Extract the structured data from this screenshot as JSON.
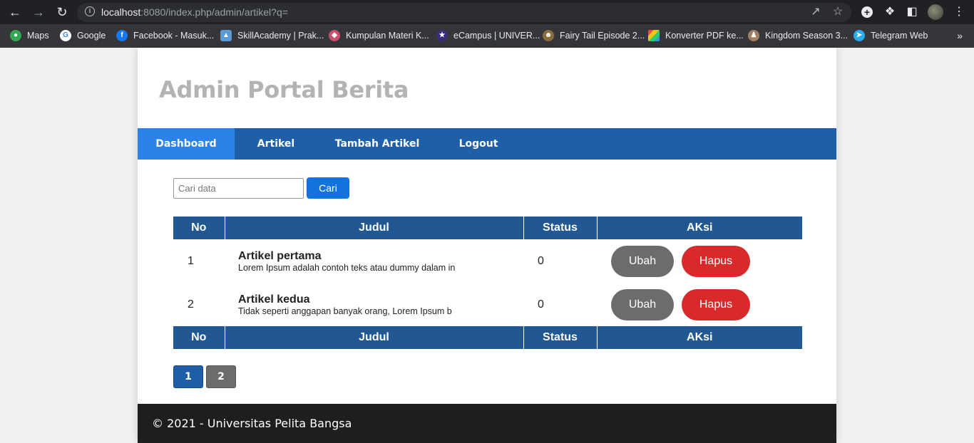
{
  "browser": {
    "url_host": "localhost",
    "url_rest": ":8080/index.php/admin/artikel?q=",
    "bookmarks": [
      {
        "label": "Maps",
        "icon": "maps-icon",
        "color": "#34a853"
      },
      {
        "label": "Google",
        "icon": "google-icon",
        "color": "#4285f4"
      },
      {
        "label": "Facebook - Masuk...",
        "icon": "facebook-icon",
        "color": "#1877f2"
      },
      {
        "label": "SkillAcademy | Prak...",
        "icon": "skillacademy-icon",
        "color": "#5b9bd5"
      },
      {
        "label": "Kumpulan Materi K...",
        "icon": "kumpulan-materi-icon",
        "color": "#c94f6d"
      },
      {
        "label": "eCampus | UNIVER...",
        "icon": "ecampus-icon",
        "color": "#3a2a7a"
      },
      {
        "label": "Fairy Tail Episode 2...",
        "icon": "fairy-tail-icon",
        "color": "#8a6d3b"
      },
      {
        "label": "Konverter PDF ke...",
        "icon": "pdf-converter-icon",
        "color": "#e84c3d"
      },
      {
        "label": "Kingdom Season 3...",
        "icon": "kingdom-icon",
        "color": "#a08060"
      },
      {
        "label": "Telegram Web",
        "icon": "telegram-icon",
        "color": "#2aabee"
      }
    ]
  },
  "site": {
    "title": "Admin Portal Berita",
    "nav": [
      {
        "label": "Dashboard",
        "active": true
      },
      {
        "label": "Artikel",
        "active": false
      },
      {
        "label": "Tambah Artikel",
        "active": false
      },
      {
        "label": "Logout",
        "active": false
      }
    ]
  },
  "search": {
    "placeholder": "Cari data",
    "value": "",
    "button_label": "Cari"
  },
  "table": {
    "headers": [
      "No",
      "Judul",
      "Status",
      "AKsi"
    ],
    "rows": [
      {
        "no": "1",
        "title": "Artikel pertama",
        "excerpt": "Lorem Ipsum adalah contoh teks atau dummy dalam in",
        "status": "0",
        "edit_label": "Ubah",
        "delete_label": "Hapus"
      },
      {
        "no": "2",
        "title": "Artikel kedua",
        "excerpt": "Tidak seperti anggapan banyak orang, Lorem Ipsum b",
        "status": "0",
        "edit_label": "Ubah",
        "delete_label": "Hapus"
      }
    ]
  },
  "pagination": {
    "pages": [
      "1",
      "2"
    ],
    "current": "1"
  },
  "footer": {
    "text": "© 2021 - Universitas Pelita Bangsa"
  },
  "colors": {
    "nav_bg": "#1f5fa9",
    "nav_active": "#2b83ea",
    "table_header": "#215891",
    "edit_button": "#6c6c6c",
    "delete_button": "#d9292b",
    "footer_bg": "#1e1e1e"
  }
}
